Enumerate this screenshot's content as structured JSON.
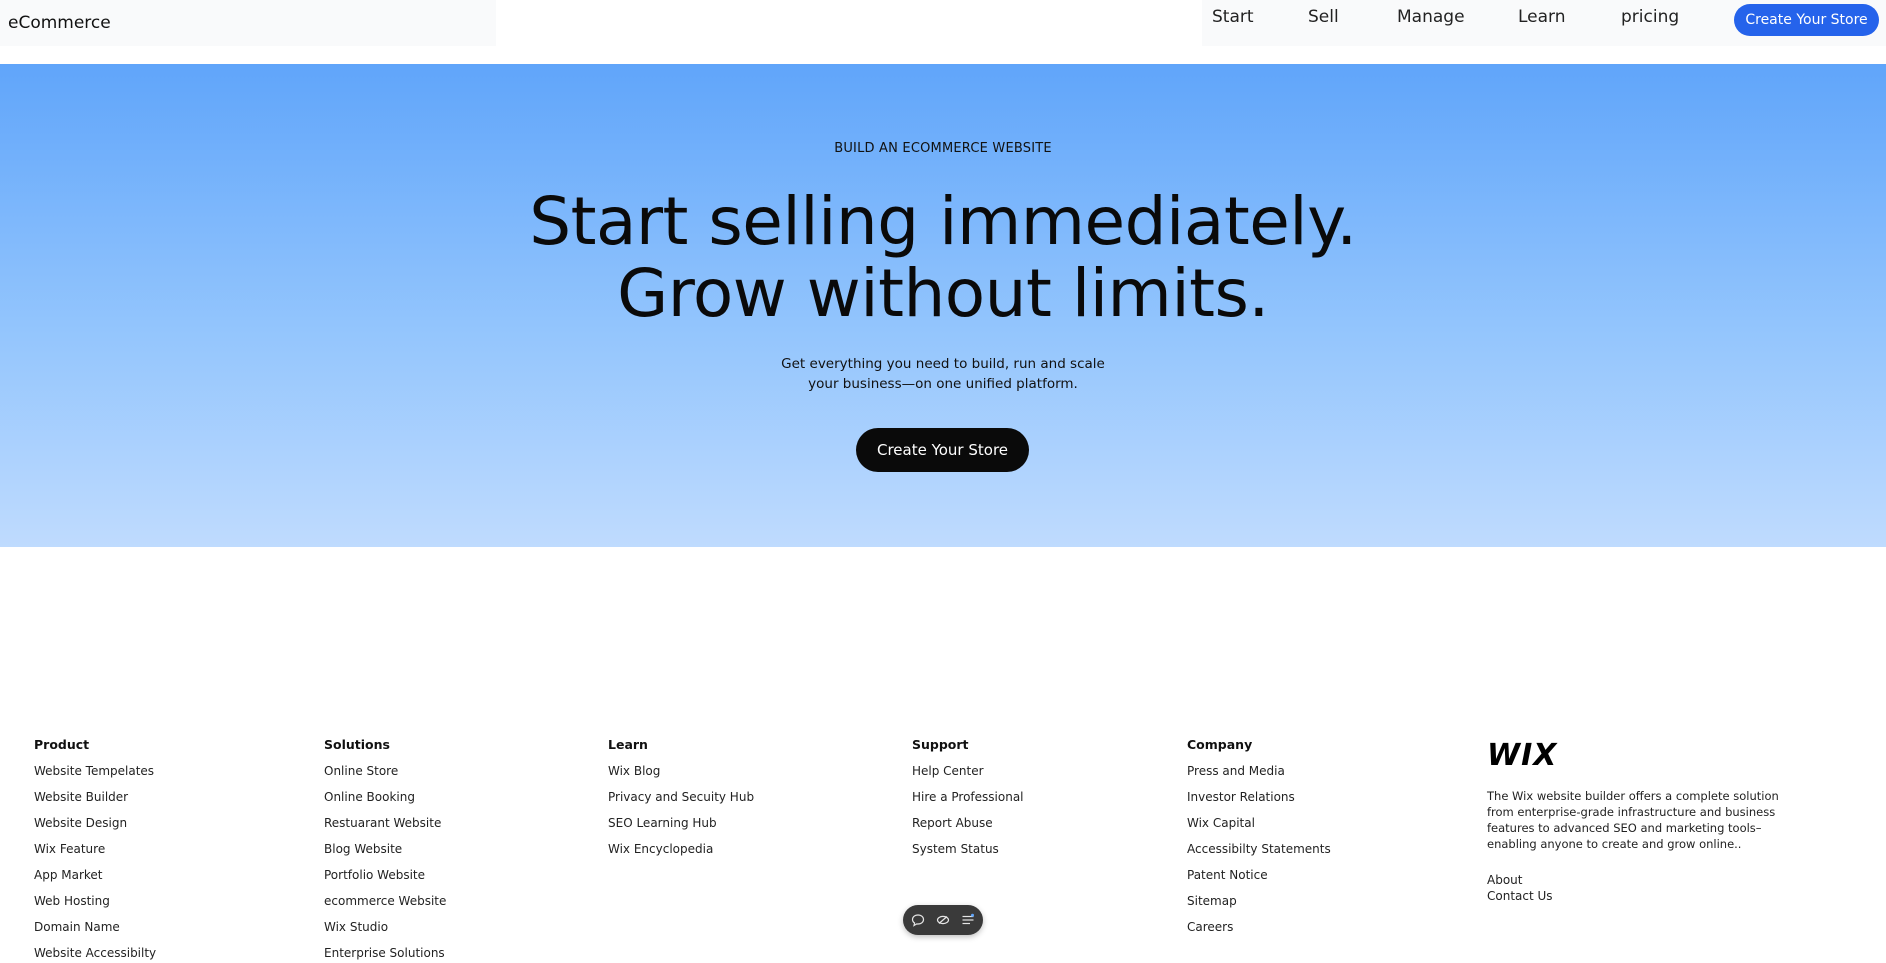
{
  "header": {
    "brand": "eCommerce",
    "nav": [
      {
        "label": "Start"
      },
      {
        "label": "Sell"
      },
      {
        "label": "Manage"
      },
      {
        "label": "Learn"
      },
      {
        "label": "pricing"
      }
    ],
    "cta_label": "Create Your Store",
    "cta_color": "#2563eb"
  },
  "hero": {
    "eyebrow": "BUILD AN ECOMMERCE WEBSITE",
    "title_line1": "Start selling immediately.",
    "title_line2": "Grow without limits.",
    "subtitle": "Get everything you need to build, run and scale your business—on one unified platform.",
    "cta_label": "Create Your Store",
    "gradient_top": "#60a5fa",
    "gradient_bottom": "#bfdbfe"
  },
  "footer": {
    "columns": [
      {
        "heading": "Product",
        "links": [
          "Website Tempelates",
          "Website Builder",
          "Website Design",
          "Wix Feature",
          "App Market",
          "Web Hosting",
          "Domain Name",
          "Website Accessibilty"
        ]
      },
      {
        "heading": "Solutions",
        "links": [
          "Online Store",
          "Online Booking",
          "Restuarant Website",
          "Blog Website",
          "Portfolio Website",
          "ecommerce Website",
          "Wix Studio",
          "Enterprise Solutions"
        ]
      },
      {
        "heading": "Learn",
        "links": [
          "Wix Blog",
          "Privacy and Secuity Hub",
          "SEO Learning Hub",
          "Wix Encyclopedia"
        ]
      },
      {
        "heading": "Support",
        "links": [
          "Help Center",
          "Hire a Professional",
          "Report Abuse",
          "System Status"
        ]
      },
      {
        "heading": "Company",
        "links": [
          "Press and Media",
          "Investor Relations",
          "Wix Capital",
          "Accessibilty Statements",
          "Patent Notice",
          "Sitemap",
          "Careers"
        ]
      }
    ],
    "wix": {
      "logo": "WIX",
      "description": "The Wix website builder offers a complete solution from enterprise-grade infrastructure and business features to advanced SEO and marketing tools–enabling anyone to create and grow online..",
      "links": [
        "About",
        "Contact Us"
      ]
    }
  },
  "floating_toolbar": {
    "icons": [
      "chat-bubble-icon",
      "eye-slash-icon",
      "settings-list-icon"
    ]
  }
}
